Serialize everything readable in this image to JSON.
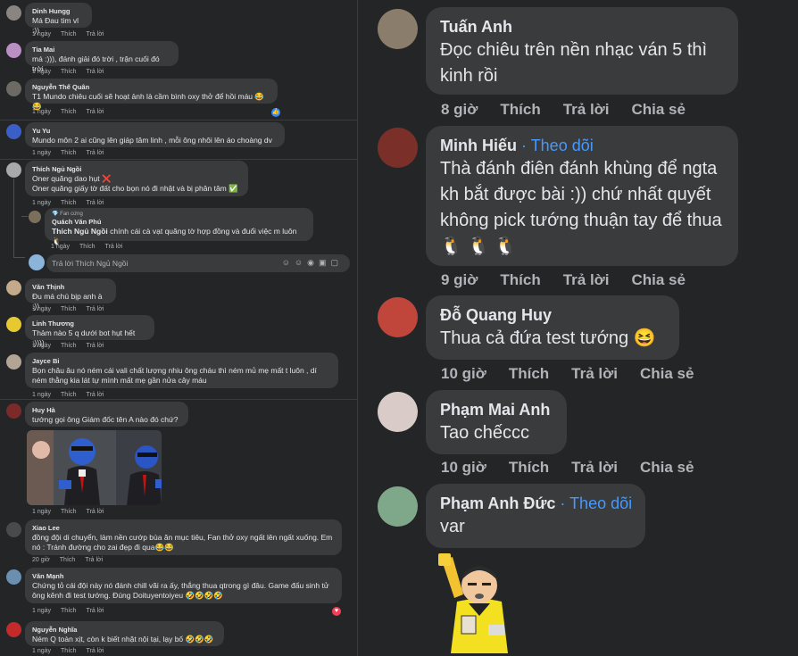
{
  "left_actions": {
    "like": "Thích",
    "reply": "Trả lời"
  },
  "left_comments": [
    {
      "name": "Dinh Hungg",
      "text": "Má Đau tim vl :))",
      "time": "1 ngày"
    },
    {
      "name": "Tia Mai",
      "text": "má :))), đánh giải đó trời , trận cuối đó trời",
      "time": "1 ngày"
    },
    {
      "name": "Nguyễn Thế Quân",
      "text": "T1 Mundo chiêu cuối sẽ hoạt ảnh là cầm bình oxy thở để hồi máu 😂😂",
      "time": "1 ngày"
    },
    {
      "name": "Yu Yu",
      "text": "Mundo môn 2 ai cũng lên giáp tâm linh , mỗi ông nhôi lên áo choàng dv",
      "time": "1 ngày"
    },
    {
      "name": "Thích Ngủ Ngồi",
      "text1": "Oner quăng dao hụt ❌",
      "text2": "Oner quăng giấy tờ đất cho bọn nó đi nhật và bị phân tâm ✅",
      "time": "1 ngày"
    },
    {
      "badge": "Fan cứng",
      "name": "Quách Văn Phú",
      "mention": "Thích Ngủ Ngồi",
      "text": " chính cái cà vạt quăng tờ hợp đồng và đuổi việc m luôn 🐧",
      "time": "1 ngày"
    },
    {
      "name": "Văn Thịnh",
      "text": "Đu má chú bịp anh à :))",
      "time": "1 ngày"
    },
    {
      "name": "Linh Thương",
      "text": "Thảm nào 5 q dưới bot hụt hết :))))",
      "time": "1 ngày"
    },
    {
      "name": "Jayce Bi",
      "text": "Bọn châu âu nó ném cái vali chất lượng nhiu ông cháu thì ném mủ mẹ mất t luôn , dí ném thằng kia lát tự mình mất mẹ gần nửa cây máu",
      "time": "1 ngày"
    },
    {
      "name": "Huy Hà",
      "text": "tướng gọi ông Giám đốc tên A nào đó chứ?",
      "time": "1 ngày"
    },
    {
      "name": "Xiao Lee",
      "text": "đồng đội di chuyển, làm nền cướp bùa ăn mục tiêu, Fan thở oxy ngất lên ngất xuống. Em nó : Tránh đường cho zai đẹp đi qua😂😂",
      "time": "20 giờ"
    },
    {
      "name": "Văn Mạnh",
      "text": "Chứng tỏ cái đội này nó đánh chill vãi ra ấy, thắng thua qtrong gì đâu. Game đấu sinh tử ông kênh đi test tướng. Đúng Doituyentoiyeu 🤣🤣🤣🤣",
      "time": "1 ngày"
    },
    {
      "name": "Nguyễn Nghĩa",
      "text": "Ném Q toàn xịt, còn k biết nhặt nội tại, lạy bố 🤣🤣🤣",
      "time": "1 ngày"
    }
  ],
  "reply_box": {
    "placeholder": "Trả lời Thích Ngủ Ngồi"
  },
  "right_actions": {
    "like": "Thích",
    "reply": "Trả lời",
    "share": "Chia sẻ"
  },
  "follow_label": "Theo dõi",
  "right_comments": [
    {
      "name": "Tuấn Anh",
      "text": "Đọc chiêu trên nền nhạc ván 5 thì kinh rồi",
      "time": "8 giờ"
    },
    {
      "name": "Minh Hiếu",
      "text": "Thà đánh điên đánh khùng để ngta kh bắt được bài :)) chứ nhất quyết không pick tướng thuận tay để thua 🐧 🐧 🐧",
      "time": "9 giờ"
    },
    {
      "name": "Đỗ Quang Huy",
      "text": "Thua cả đứa test tướng 😆",
      "time": "10 giờ"
    },
    {
      "name": "Phạm Mai Anh",
      "text": "Tao chếccc",
      "time": "10 giờ"
    },
    {
      "name": "Phạm Anh Đức",
      "text": "var"
    }
  ],
  "colors": {
    "bg": "#242526",
    "bubble": "#3a3b3c",
    "text": "#e4e6eb",
    "muted": "#b0b3b8",
    "link": "#4599ff"
  }
}
